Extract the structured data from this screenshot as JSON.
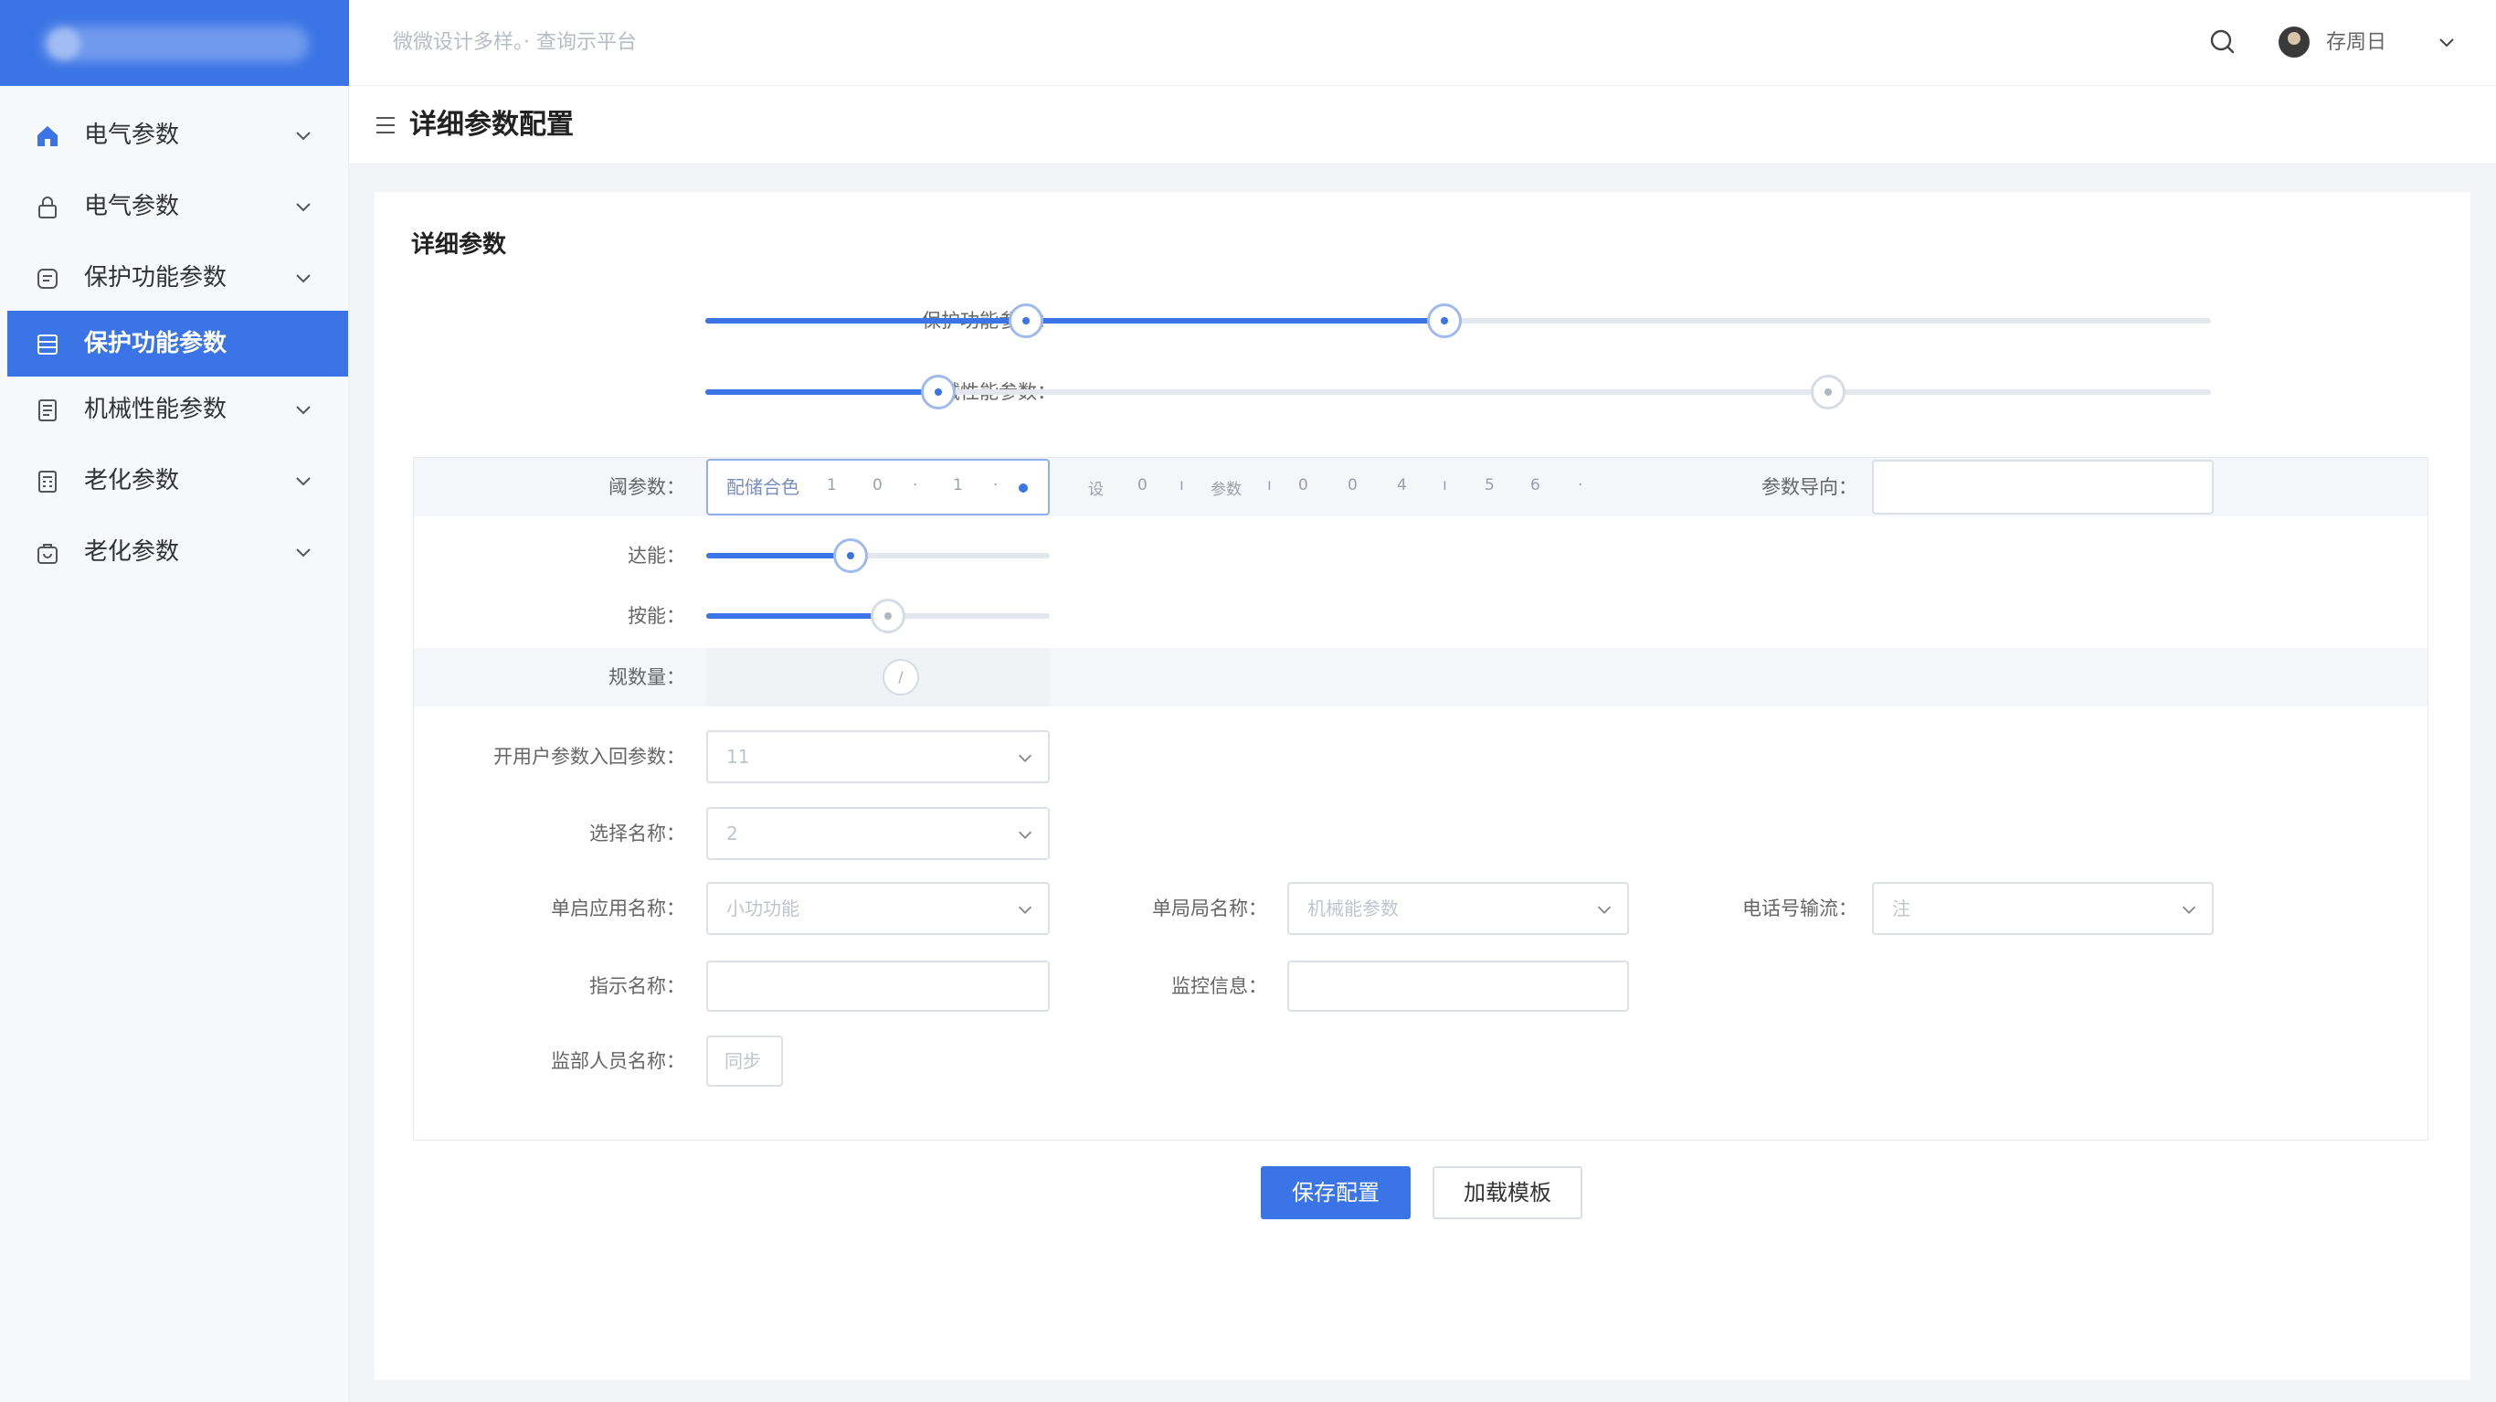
{
  "colors": {
    "primary": "#3b74e6",
    "sidebar_bg": "#f7f8fa",
    "track": "#e4e7ed"
  },
  "header": {
    "subtitle": "微微设计多样。· 查询示平台",
    "username": "存周日"
  },
  "sidebar": {
    "items": [
      {
        "label": "电气参数",
        "icon": "home-icon"
      },
      {
        "label": "电气参数",
        "icon": "lock-icon"
      },
      {
        "label": "保护功能参数",
        "icon": "shield-icon"
      },
      {
        "label": "保护功能参数",
        "icon": "list-icon",
        "active": true
      },
      {
        "label": "机械性能参数",
        "icon": "document-icon"
      },
      {
        "label": "老化参数",
        "icon": "calculator-icon"
      },
      {
        "label": "老化参数",
        "icon": "bag-icon"
      }
    ]
  },
  "page": {
    "title": "详细参数配置"
  },
  "form": {
    "section_title": "详细参数",
    "range1": {
      "label": "保护功能参数：",
      "low": 0.213,
      "high": 0.491
    },
    "range2": {
      "label": "机械性能参数：",
      "low": 0.155,
      "high": 0.746
    },
    "threshold": {
      "label": "阈参数：",
      "input_text": "配储合色",
      "ticks_in": [
        "1",
        "0",
        "1"
      ],
      "ticks_out": [
        "设",
        "0",
        "参数",
        "0",
        "0",
        "4",
        "5",
        "6"
      ]
    },
    "param_dir": {
      "label": "参数导向：",
      "value": ""
    },
    "slider_a": {
      "label": "达能：",
      "value": 0.42
    },
    "slider_b": {
      "label": "按能：",
      "value": 0.53
    },
    "toggle": {
      "label": "规数量：",
      "glyph": "/"
    },
    "select_user": {
      "label": "开用户参数入回参数：",
      "value": "11"
    },
    "select_name": {
      "label": "选择名称：",
      "value": "2"
    },
    "select_single": {
      "label": "单启应用名称：",
      "value": "小功功能"
    },
    "select_unit": {
      "label": "单局局名称：",
      "value": "机械能参数"
    },
    "select_phone": {
      "label": "电话号输流：",
      "value": "注"
    },
    "input_a": {
      "label": "指示名称：",
      "value": ""
    },
    "input_b": {
      "label": "监控信息：",
      "value": ""
    },
    "small": {
      "label": "监部人员名称：",
      "value": "同步"
    }
  },
  "buttons": {
    "save": "保存配置",
    "load": "加载模板"
  }
}
